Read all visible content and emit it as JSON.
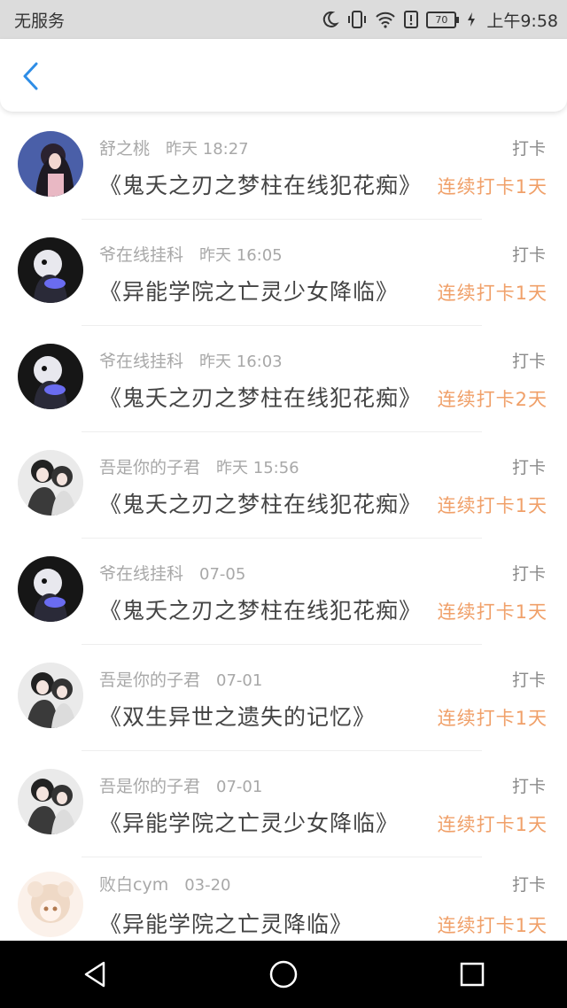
{
  "status_bar": {
    "carrier": "无服务",
    "battery": "70",
    "time": "上午9:58",
    "icons": [
      "moon-icon",
      "vibrate-icon",
      "wifi-icon",
      "sim-alert-icon",
      "battery-icon",
      "charging-icon"
    ]
  },
  "header": {
    "back_icon": "chevron-left-icon",
    "accent_color": "#2e8de6"
  },
  "records": [
    {
      "user": "舒之桃",
      "time": "昨天 18:27",
      "kind": "打卡",
      "title": "《鬼夭之刃之梦柱在线犯花痴》",
      "streak": "连续打卡1天",
      "avatar": "avatar-girl-long-hair"
    },
    {
      "user": "爷在线挂科",
      "time": "昨天 16:05",
      "kind": "打卡",
      "title": "《异能学院之亡灵少女降临》",
      "streak": "连续打卡1天",
      "avatar": "avatar-dark-figure"
    },
    {
      "user": "爷在线挂科",
      "time": "昨天 16:03",
      "kind": "打卡",
      "title": "《鬼夭之刃之梦柱在线犯花痴》",
      "streak": "连续打卡2天",
      "avatar": "avatar-dark-figure"
    },
    {
      "user": "吾是你的子君",
      "time": "昨天 15:56",
      "kind": "打卡",
      "title": "《鬼夭之刃之梦柱在线犯花痴》",
      "streak": "连续打卡1天",
      "avatar": "avatar-anime-pair"
    },
    {
      "user": "爷在线挂科",
      "time": "07-05",
      "kind": "打卡",
      "title": "《鬼夭之刃之梦柱在线犯花痴》",
      "streak": "连续打卡1天",
      "avatar": "avatar-dark-figure"
    },
    {
      "user": "吾是你的子君",
      "time": "07-01",
      "kind": "打卡",
      "title": "《双生异世之遗失的记忆》",
      "streak": "连续打卡1天",
      "avatar": "avatar-anime-pair"
    },
    {
      "user": "吾是你的子君",
      "time": "07-01",
      "kind": "打卡",
      "title": "《异能学院之亡灵少女降临》",
      "streak": "连续打卡1天",
      "avatar": "avatar-anime-pair"
    },
    {
      "user": "败白cym",
      "time": "03-20",
      "kind": "打卡",
      "title": "《异能学院之亡灵降临》",
      "streak": "连续打卡1天",
      "avatar": "avatar-light-hair"
    }
  ],
  "colors": {
    "streak": "#f0a069",
    "meta": "#a8a8a8",
    "title": "#444444"
  },
  "nav_bar": {
    "icons": [
      "back-triangle-icon",
      "home-circle-icon",
      "recents-square-icon"
    ]
  }
}
